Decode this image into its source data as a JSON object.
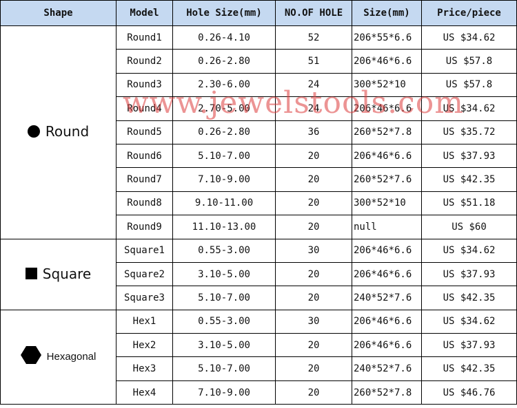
{
  "headers": {
    "shape": "Shape",
    "model": "Model",
    "hole_size": "Hole Size(mm)",
    "no_of_hole": "NO.OF HOLE",
    "size": "Size(mm)",
    "price": "Price/piece"
  },
  "groups": [
    {
      "shape_label": "Round",
      "shape_icon": "filled-circle-icon",
      "rows": [
        {
          "model": "Round1",
          "hole_size": "0.26-4.10",
          "no_of_hole": "52",
          "size": "206*55*6.6",
          "price": "US $34.62"
        },
        {
          "model": "Round2",
          "hole_size": "0.26-2.80",
          "no_of_hole": "51",
          "size": "206*46*6.6",
          "price": "US $57.8"
        },
        {
          "model": "Round3",
          "hole_size": "2.30-6.00",
          "no_of_hole": "24",
          "size": "300*52*10",
          "price": "US $57.8"
        },
        {
          "model": "Round4",
          "hole_size": "2.70-5.00",
          "no_of_hole": "24",
          "size": "206*46*6.6",
          "price": "US $34.62"
        },
        {
          "model": "Round5",
          "hole_size": "0.26-2.80",
          "no_of_hole": "36",
          "size": "260*52*7.8",
          "price": "US $35.72"
        },
        {
          "model": "Round6",
          "hole_size": "5.10-7.00",
          "no_of_hole": "20",
          "size": "206*46*6.6",
          "price": "US $37.93"
        },
        {
          "model": "Round7",
          "hole_size": "7.10-9.00",
          "no_of_hole": "20",
          "size": "260*52*7.6",
          "price": "US $42.35"
        },
        {
          "model": "Round8",
          "hole_size": "9.10-11.00",
          "no_of_hole": "20",
          "size": "300*52*10",
          "price": "US $51.18"
        },
        {
          "model": "Round9",
          "hole_size": "11.10-13.00",
          "no_of_hole": "20",
          "size": "null",
          "price": "US $60"
        }
      ]
    },
    {
      "shape_label": "Square",
      "shape_icon": "filled-square-icon",
      "rows": [
        {
          "model": "Square1",
          "hole_size": "0.55-3.00",
          "no_of_hole": "30",
          "size": "206*46*6.6",
          "price": "US $34.62"
        },
        {
          "model": "Square2",
          "hole_size": "3.10-5.00",
          "no_of_hole": "20",
          "size": "206*46*6.6",
          "price": "US $37.93"
        },
        {
          "model": "Square3",
          "hole_size": "5.10-7.00",
          "no_of_hole": "20",
          "size": "240*52*7.6",
          "price": "US $42.35"
        }
      ]
    },
    {
      "shape_label": "Hexagonal",
      "shape_icon": "filled-hexagon-icon",
      "rows": [
        {
          "model": "Hex1",
          "hole_size": "0.55-3.00",
          "no_of_hole": "30",
          "size": "206*46*6.6",
          "price": "US $34.62"
        },
        {
          "model": "Hex2",
          "hole_size": "3.10-5.00",
          "no_of_hole": "20",
          "size": "206*46*6.6",
          "price": "US $37.93"
        },
        {
          "model": "Hex3",
          "hole_size": "5.10-7.00",
          "no_of_hole": "20",
          "size": "240*52*7.6",
          "price": "US $42.35"
        },
        {
          "model": "Hex4",
          "hole_size": "7.10-9.00",
          "no_of_hole": "20",
          "size": "260*52*7.8",
          "price": "US $46.76"
        }
      ]
    }
  ],
  "watermark": "www.jewelstools.com",
  "colors": {
    "header_bg": "#c5d9f1",
    "watermark": "#dc3c3c"
  }
}
